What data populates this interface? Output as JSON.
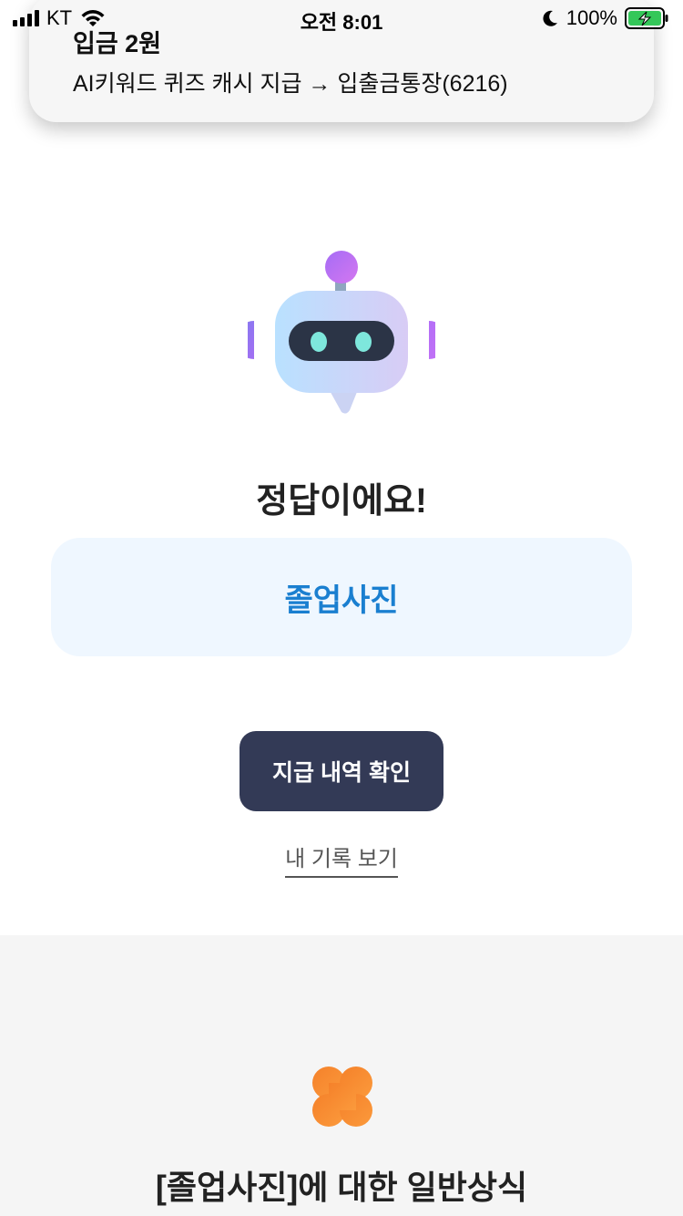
{
  "status_bar": {
    "carrier": "KT",
    "time": "오전 8:01",
    "battery_percent": "100%",
    "battery_level": 1.0
  },
  "notification": {
    "title": "입금 2원",
    "body": "AI키워드 퀴즈 캐시 지급 → 입출금통장(6216)"
  },
  "result": {
    "heading": "정답이에요!",
    "answer": "졸업사진"
  },
  "actions": {
    "primary_label": "지급 내역 확인",
    "link_label": "내 기록 보기"
  },
  "trivia": {
    "title": "[졸업사진]에 대한 일반상식"
  },
  "colors": {
    "accent_blue": "#1a7fd0",
    "button_dark": "#333a56",
    "card_bg": "#eff7ff",
    "clover_orange": "#f5812a",
    "battery_green": "#34c759"
  },
  "icons": [
    "signal-icon",
    "wifi-icon",
    "moon-icon",
    "battery-charging-icon",
    "robot-icon",
    "clover-icon"
  ]
}
